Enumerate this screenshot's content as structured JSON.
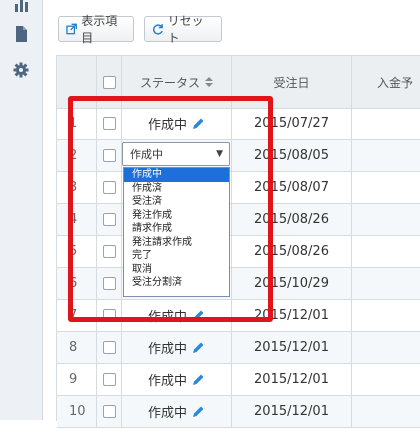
{
  "toolbar": {
    "display_items_label": "表示項目",
    "reset_label": "リセット"
  },
  "table": {
    "headers": {
      "status": "ステータス",
      "order_date": "受注日",
      "payment": "入金予"
    },
    "rows": [
      {
        "num": "1",
        "status": "作成中",
        "date": "2015/07/27"
      },
      {
        "num": "2",
        "status": "作成中",
        "date": "2015/08/05"
      },
      {
        "num": "3",
        "status": "",
        "date": "2015/08/07"
      },
      {
        "num": "4",
        "status": "",
        "date": "2015/08/26"
      },
      {
        "num": "5",
        "status": "",
        "date": "2015/08/26"
      },
      {
        "num": "6",
        "status": "",
        "date": "2015/10/29"
      },
      {
        "num": "7",
        "status": "作成中",
        "date": "2015/12/01"
      },
      {
        "num": "8",
        "status": "作成中",
        "date": "2015/12/01"
      },
      {
        "num": "9",
        "status": "作成中",
        "date": "2015/12/01"
      },
      {
        "num": "10",
        "status": "作成中",
        "date": "2015/12/01"
      }
    ]
  },
  "status_select": {
    "selected": "作成中",
    "options": [
      "作成中",
      "作成済",
      "受注済",
      "発注作成",
      "請求作成",
      "発注請求作成",
      "完了",
      "取消",
      "受注分割済"
    ]
  },
  "colors": {
    "accent": "#1e6fd9",
    "highlight": "#e0141b",
    "pencil": "#2a8ad4"
  },
  "icons": [
    "bar-chart-icon",
    "document-icon",
    "gear-icon",
    "external-link-icon",
    "reset-icon",
    "sort-icon",
    "pencil-icon",
    "chevron-down-icon"
  ]
}
